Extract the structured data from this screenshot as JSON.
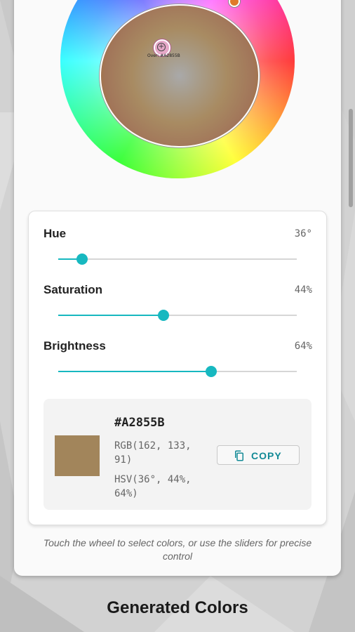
{
  "hsv_sliders": {
    "hue": {
      "label": "Hue",
      "value_text": "36°",
      "position": 0.1
    },
    "saturation": {
      "label": "Saturation",
      "value_text": "44%",
      "position": 0.44
    },
    "brightness": {
      "label": "Brightness",
      "value_text": "64%",
      "position": 0.64
    }
  },
  "wheel": {
    "marker_label": "Over: #A2855B"
  },
  "color_preview": {
    "hex": "#A2855B",
    "rgb": "RGB(162, 133, 91)",
    "hsv": "HSV(36°, 44%, 64%)",
    "swatch_color": "#A2855B",
    "copy_label": "COPY"
  },
  "hint_text": "Touch the wheel to select colors, or use the sliders for precise control",
  "section_title": "Generated Colors",
  "colors": {
    "accent": "#17b8c0",
    "copy_text": "#138a96"
  },
  "icons": {
    "copy": "copy-icon",
    "marker": "crosshair-icon"
  }
}
